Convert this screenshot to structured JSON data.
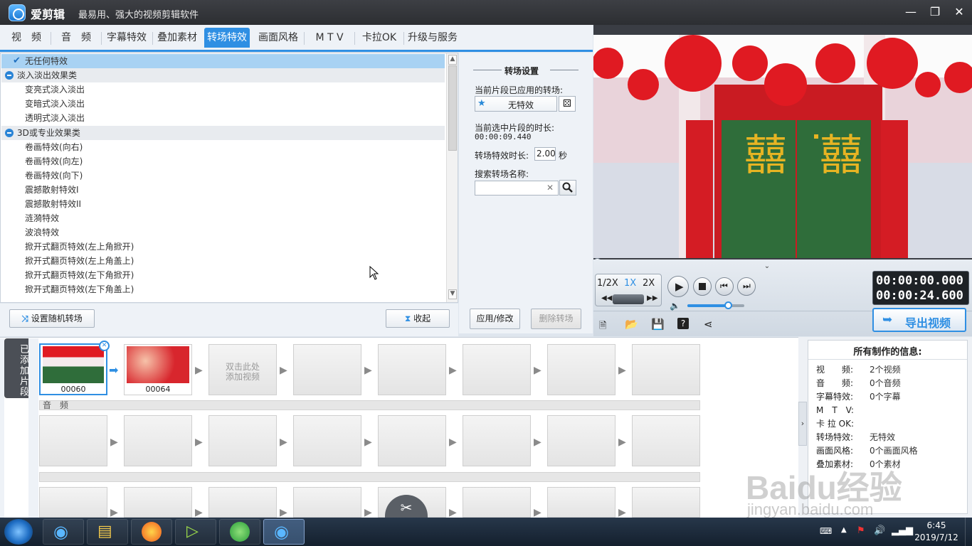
{
  "app": {
    "name": "爱剪辑",
    "slogan": "最易用、强大的视频剪辑软件"
  },
  "window_controls": {
    "minimize": "—",
    "restore": "❐",
    "close": "✕"
  },
  "tabs": [
    {
      "label": "视　频"
    },
    {
      "label": "音　频"
    },
    {
      "label": "字幕特效"
    },
    {
      "label": "叠加素材"
    },
    {
      "label": "转场特效",
      "active": true
    },
    {
      "label": "画面风格"
    },
    {
      "label": "M T V"
    },
    {
      "label": "卡拉OK"
    },
    {
      "label": "升级与服务"
    }
  ],
  "effects": {
    "none": "无任何特效",
    "cat1": "淡入淡出效果类",
    "cat1_items": [
      "变亮式淡入淡出",
      "变暗式淡入淡出",
      "透明式淡入淡出"
    ],
    "cat2": "3D或专业效果类",
    "cat2_items": [
      "卷画特效(向右)",
      "卷画特效(向左)",
      "卷画特效(向下)",
      "震撼散射特效I",
      "震撼散射特效II",
      "涟漪特效",
      "波浪特效",
      "掀开式翻页特效(左上角掀开)",
      "掀开式翻页特效(左上角盖上)",
      "掀开式翻页特效(左下角掀开)",
      "掀开式翻页特效(左下角盖上)"
    ]
  },
  "buttons": {
    "random": "设置随机转场",
    "collapse": "收起",
    "apply": "应用/修改",
    "delete": "删除转场",
    "export": "导出视频"
  },
  "settings": {
    "title": "转场设置",
    "applied_label": "当前片段已应用的转场:",
    "applied_value": "无特效",
    "duration_label": "当前选中片段的时长:",
    "duration_value": "00:00:09.440",
    "effect_len_label": "转场特效时长:",
    "effect_len_value": "2.00",
    "effect_len_unit": "秒",
    "search_label": "搜索转场名称:",
    "search_value": "",
    "search_clear": "✕"
  },
  "player": {
    "speeds": [
      "1/2X",
      "1X",
      "2X"
    ],
    "active_speed": "1X",
    "time_current": "00:00:00.000",
    "time_total": "00:00:24.600",
    "progress": 0.0,
    "volume": 0.68
  },
  "timeline": {
    "side_label": "已添加片段",
    "clips": [
      {
        "name": "00060"
      },
      {
        "name": "00064"
      }
    ],
    "add_hint_line1": "双击此处",
    "add_hint_line2": "添加视频",
    "audio_label": "音　频"
  },
  "info": {
    "title": "所有制作的信息:",
    "rows": [
      {
        "k": "视　　频:",
        "v": "2个视频"
      },
      {
        "k": "音　　频:",
        "v": "0个音频"
      },
      {
        "k": "字幕特效:",
        "v": "0个字幕"
      },
      {
        "k": "M　T　V:",
        "v": ""
      },
      {
        "k": "卡 拉 OK:",
        "v": ""
      },
      {
        "k": "转场特效:",
        "v": "无特效"
      },
      {
        "k": "画面风格:",
        "v": "0个画面风格"
      },
      {
        "k": "叠加素材:",
        "v": "0个素材"
      }
    ]
  },
  "watermark": {
    "brand": "Baidu经验",
    "url": "jingyan.baidu.com"
  },
  "taskbar": {
    "time": "6:45",
    "date": "2019/7/12"
  },
  "colors": {
    "accent": "#2f8fe3",
    "titlebar": "#333539",
    "selected_row": "#a8d2f3",
    "lantern_red": "#e01a22"
  }
}
